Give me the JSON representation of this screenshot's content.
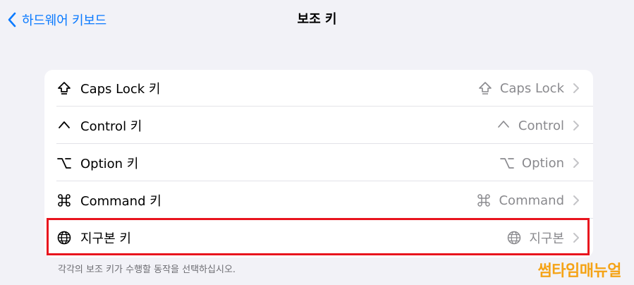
{
  "navbar": {
    "back_label": "하드웨어 키보드",
    "title": "보조 키"
  },
  "rows": [
    {
      "icon": "caps-lock-icon",
      "label": "Caps Lock 키",
      "value": "Caps Lock"
    },
    {
      "icon": "control-icon",
      "label": "Control 키",
      "value": "Control"
    },
    {
      "icon": "option-icon",
      "label": "Option 키",
      "value": "Option"
    },
    {
      "icon": "command-icon",
      "label": "Command 키",
      "value": "Command"
    },
    {
      "icon": "globe-icon",
      "label": "지구본 키",
      "value": "지구본"
    }
  ],
  "footnote": "각각의 보조 키가 수행할 동작을 선택하십시오.",
  "watermark": "썸타임매뉴얼",
  "colors": {
    "accent": "#0a7aff",
    "highlight": "#e8141e",
    "watermark": "#f5a316"
  }
}
